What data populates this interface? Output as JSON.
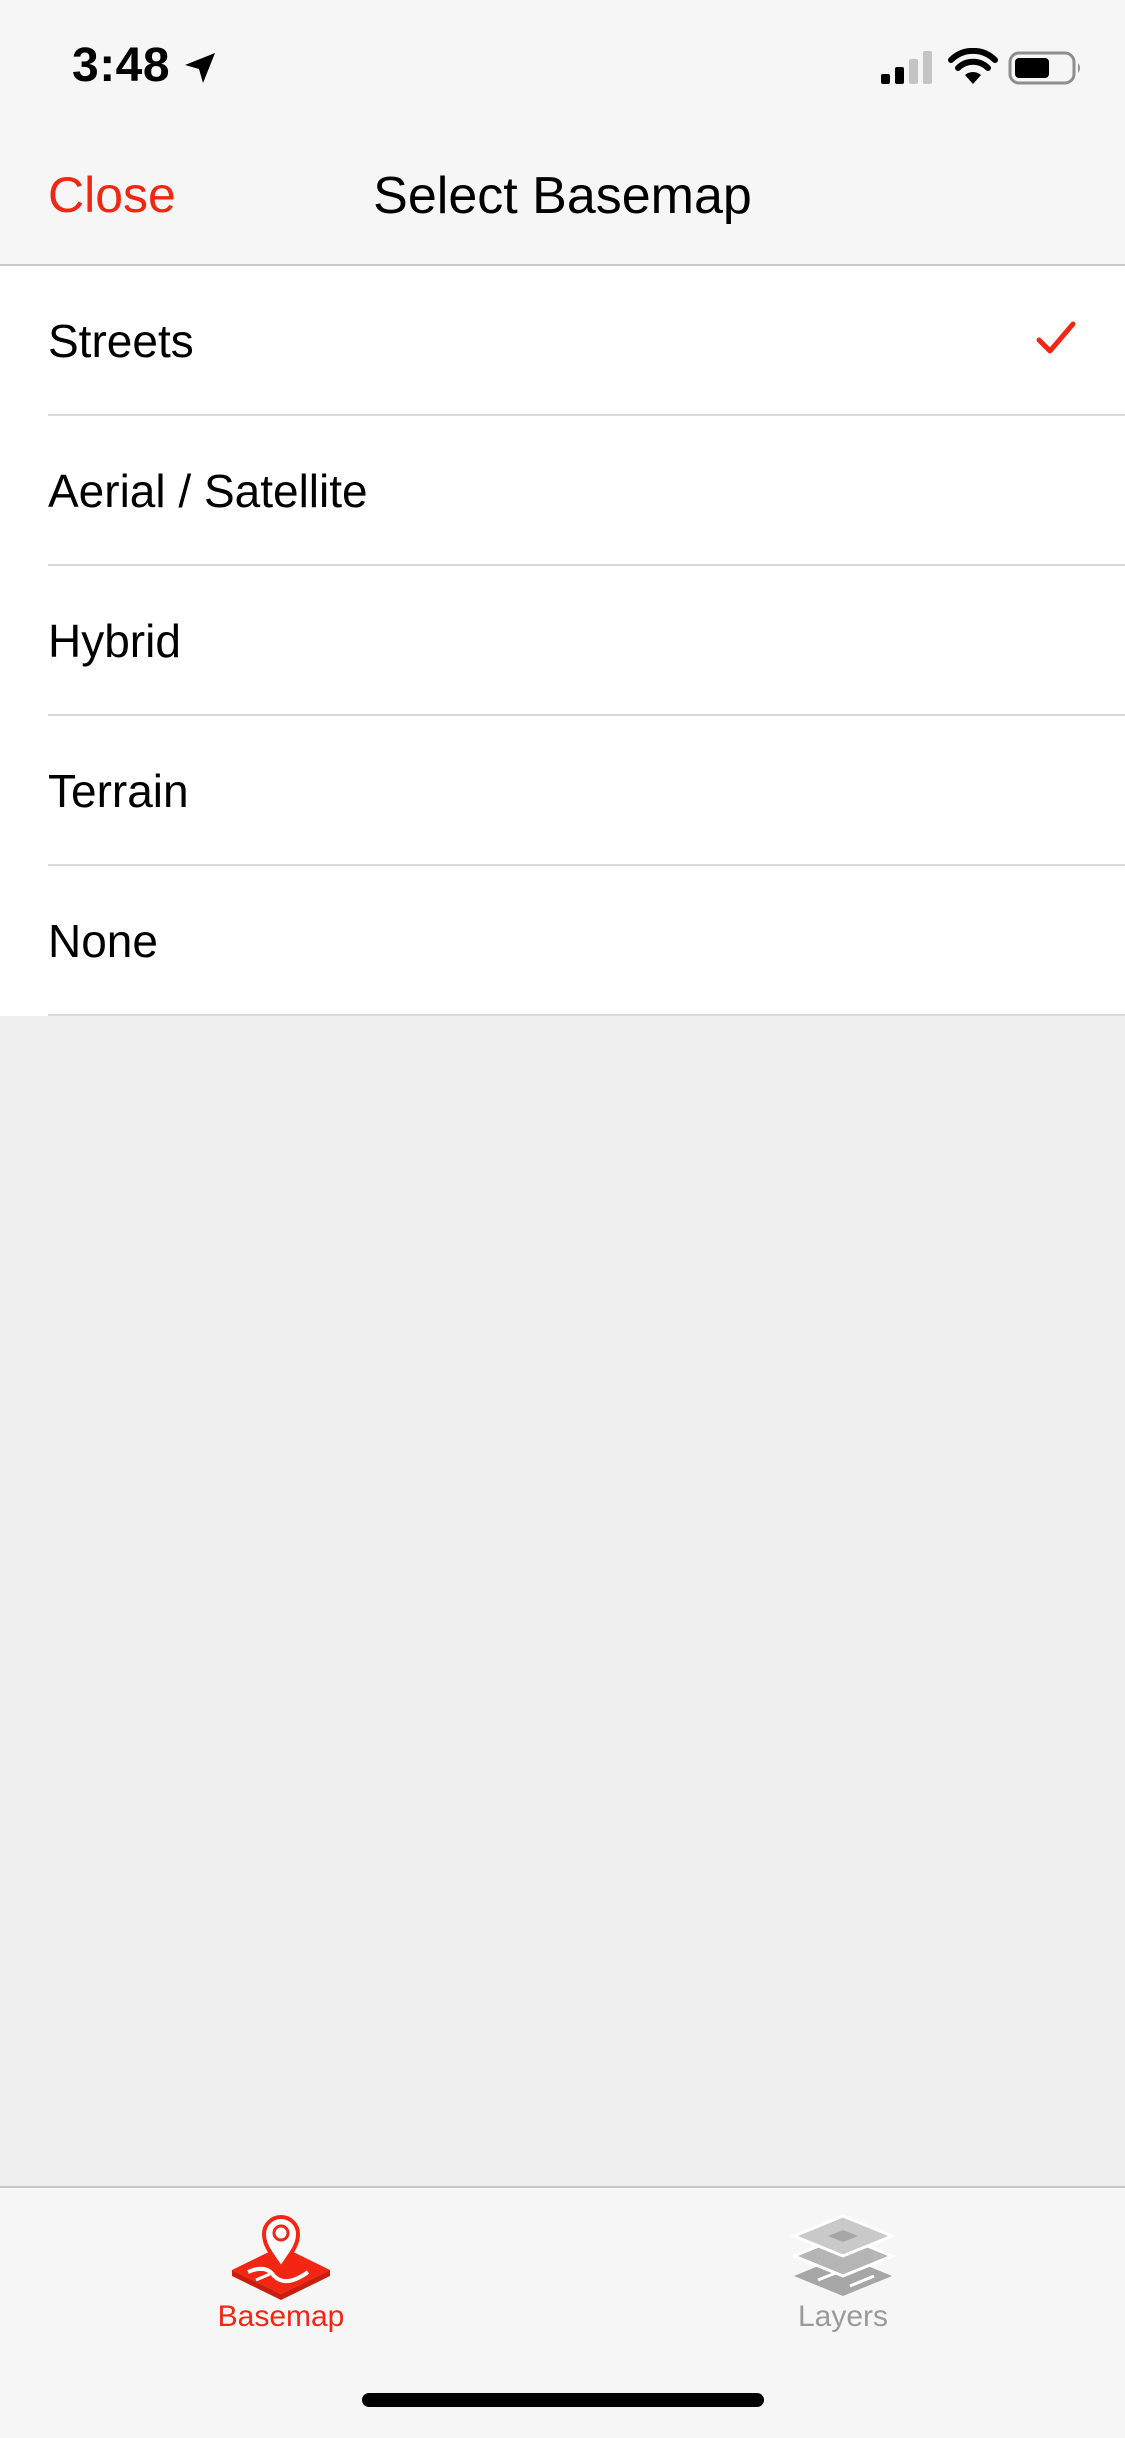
{
  "status_bar": {
    "time": "3:48",
    "icons": [
      "location-arrow-icon",
      "cellular-signal-icon",
      "wifi-icon",
      "battery-icon"
    ]
  },
  "nav": {
    "close_label": "Close",
    "title": "Select Basemap"
  },
  "basemaps": {
    "selected": "Streets",
    "items": [
      {
        "label": "Streets",
        "selected": true
      },
      {
        "label": "Aerial / Satellite",
        "selected": false
      },
      {
        "label": "Hybrid",
        "selected": false
      },
      {
        "label": "Terrain",
        "selected": false
      },
      {
        "label": "None",
        "selected": false
      }
    ]
  },
  "tabs": [
    {
      "label": "Basemap",
      "icon": "basemap-icon",
      "active": true
    },
    {
      "label": "Layers",
      "icon": "layers-icon",
      "active": false
    }
  ],
  "colors": {
    "accent": "#f22613",
    "inactive": "#9a9a9a",
    "background": "#efefef",
    "bar_background": "#f6f6f6"
  }
}
